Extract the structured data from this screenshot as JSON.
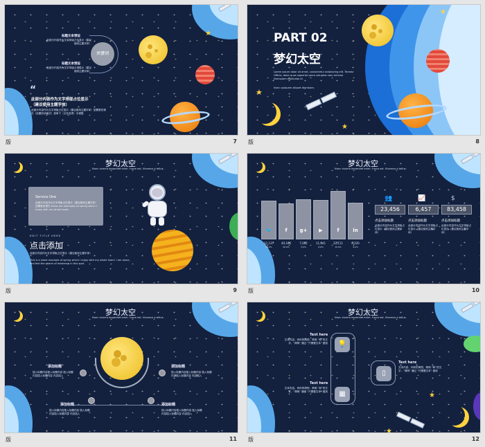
{
  "footer_label": "版",
  "slides": [
    {
      "number": "7",
      "items": [
        {
          "title": "标题文本预设",
          "text": "此部分内容作为文字排版占位显示（建议使用主题字体）"
        },
        {
          "title": "标题文本预设",
          "text": "此部分内容作为文字排版占位显示（建议使用主题字体）"
        }
      ],
      "key_label": "关键词",
      "quote_mark": "“",
      "quote_lines": [
        "此部分内容作为文字排版占位显示",
        "（建议使用主题字体）"
      ],
      "quote_small": "此部分内容作为文字排版占位显示（建议使用主题字体）如需更改请在（设置形状格式）菜单下（文本选项）中调整"
    },
    {
      "number": "8",
      "part": "PART 02",
      "title": "梦幻太空",
      "body": "Lorem ipsum dolor sit amet, consectetur adipisicing elit. Tenetur Officia, dolor quas sapiente porro voluptas nam minima Numquam explicabo id.",
      "small_line": "Nunc quiquam aliquet dignissim."
    },
    {
      "number": "9",
      "header": "梦幻太空",
      "header_sub": "Nunc viverra imperdiet enim. Fusce est. Vivamus a tellus.",
      "service_title": "Service One",
      "service_text": "此部分内容作为文字排版占位显示（建议使用主题字体）如需更改请在 these are examples of spring which I enjoy with my whole heart.",
      "edit_label": "EDIT TITLE HERE",
      "click_title": "点击添加",
      "click_sub": "此部分内容作为文字排版占位显示（建议使用主题字体）",
      "click_text": "This is a sheer example of spring which I enjoy with my whole heart. I am alone, and feel the charm of existence in this spot."
    },
    {
      "number": "10",
      "header": "梦幻太空",
      "header_sub": "Nunc viverra imperdiet enim. Fusce est. Vivamus a tellus.",
      "bars": [
        {
          "icon": "twitter-icon",
          "glyph": "🐦",
          "value": "12,137",
          "pct": "10.0%",
          "level": 0.38
        },
        {
          "icon": "facebook-icon",
          "glyph": "f",
          "value": "40,166",
          "pct": "30.0%",
          "level": 0.18
        },
        {
          "icon": "google-plus-icon",
          "glyph": "g+",
          "value": "7,002",
          "pct": "5.0%",
          "level": 0.46
        },
        {
          "icon": "youtube-icon",
          "glyph": "▶",
          "value": "11,441",
          "pct": "8.0%",
          "level": 0.4
        },
        {
          "icon": "facebook-icon",
          "glyph": "f",
          "value": "22,111",
          "pct": "15.0%",
          "level": 1.0
        },
        {
          "icon": "linkedin-icon",
          "glyph": "in",
          "value": "6,220",
          "pct": "4.2%",
          "level": 0.24
        }
      ],
      "stats": [
        {
          "icon": "people-icon",
          "value": "23,456",
          "label": "点击添加标题",
          "text": "此部分内容作为文字排版占位显示（建议使用主题字体）"
        },
        {
          "icon": "growth-chart-icon",
          "value": "6,457",
          "label": "点击添加标题",
          "text": "此部分内容作为文字排版占位显示（建议使用主题字体）"
        },
        {
          "icon": "money-bag-icon",
          "value": "83,458",
          "label": "点击添加标题",
          "text": "此部分内容作为文字排版占位显示（建议使用主题字体）"
        }
      ]
    },
    {
      "number": "11",
      "header": "梦幻太空",
      "header_sub": "Nunc viverra imperdiet enim. Fusce est. Vivamus a tellus.",
      "points": [
        {
          "title": "添加标题",
          "text": "插入标题内容插入标题内容 插入标题内容插入标题内容 内容插入"
        },
        {
          "title": "添加标题",
          "text": "插入标题内容插入标题内容 插入标题内容插入标题内容 内容插入"
        },
        {
          "title": "添加标题",
          "text": "插入标题内容插入标题内容 插入标题内容插入标题内容 内容插入"
        },
        {
          "title": "添加标题",
          "text": "插入标题内容插入标题内容 插入标题内容插入标题内容 内容插入"
        }
      ]
    },
    {
      "number": "12",
      "header": "梦幻太空",
      "header_sub": "Nunc viverra imperdiet enim. Fusce est. Vivamus a tellus.",
      "blocks": [
        {
          "title": "Text here",
          "text": "文本内容，你你的简短，简明 “和”的文字，\"简明\" 通过 \"只需要文本\" 做到"
        },
        {
          "title": "Text here",
          "text": "文本内容，你你的简短，简明 “和”的文字，\"简明\" 通过 \"只需要文本\" 做到"
        },
        {
          "title": "Text here",
          "text": "文本内容，你你的简短，简明 “和”的文字，\"简明\" 通过 \"只需要文本\" 做到"
        }
      ]
    }
  ]
}
